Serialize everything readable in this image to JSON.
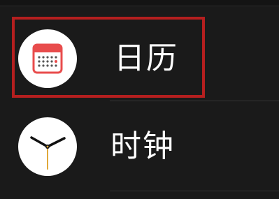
{
  "apps": [
    {
      "id": "calendar",
      "label": "日历",
      "icon": "calendar-icon",
      "selected": true
    },
    {
      "id": "clock",
      "label": "时钟",
      "icon": "clock-icon",
      "selected": false
    }
  ],
  "colors": {
    "background": "#1a1a1a",
    "highlight": "#b51f1f",
    "calendar_accent": "#e84c4c",
    "clock_second_hand": "#e0a93a",
    "text": "#ffffff"
  }
}
